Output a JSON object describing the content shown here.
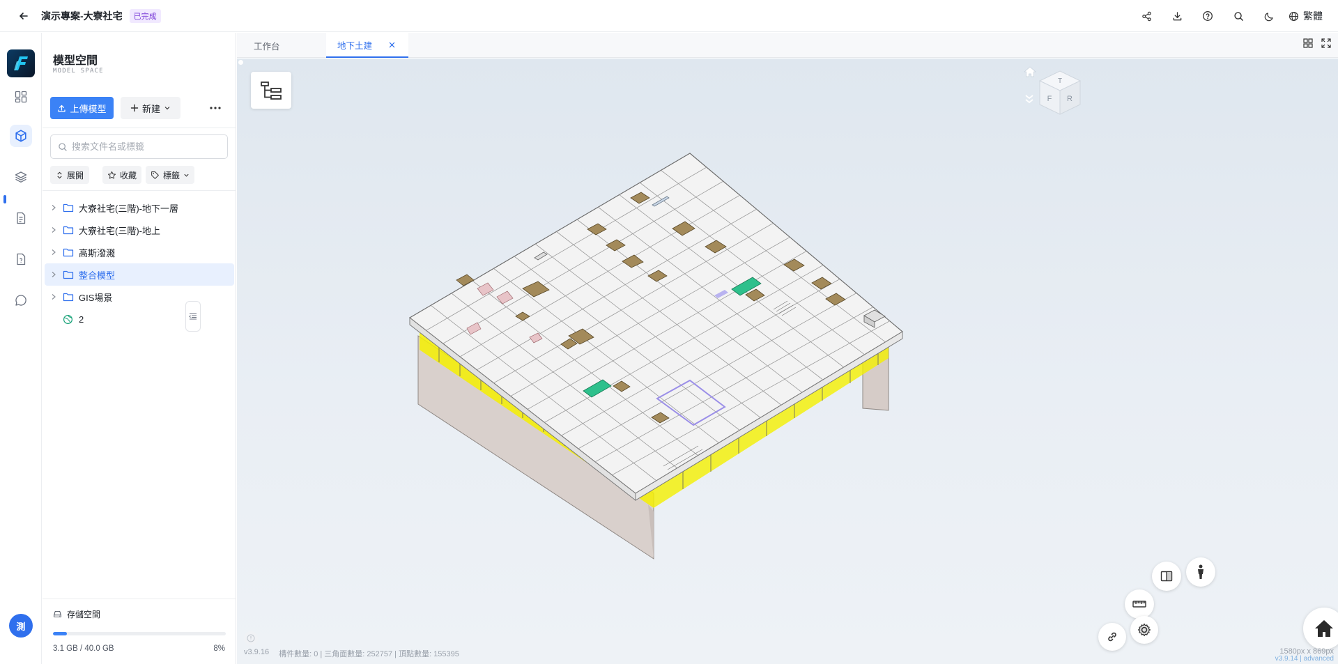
{
  "header": {
    "project_title": "演示專案-大寮社宅",
    "status_badge": "已完成",
    "language": "繁體"
  },
  "panel": {
    "title": "模型空間",
    "subtitle": "MODEL SPACE",
    "upload_label": "上傳模型",
    "new_label": "新建",
    "search_placeholder": "搜索文件名或標籤",
    "filters": {
      "expand": "展開",
      "favorite": "收藏",
      "tags": "標籤"
    },
    "tree": [
      {
        "label": "大寮社宅(三階)-地下一層",
        "type": "folder"
      },
      {
        "label": "大寮社宅(三階)-地上",
        "type": "folder"
      },
      {
        "label": "高斯潑濺",
        "type": "folder"
      },
      {
        "label": "整合模型",
        "type": "folder"
      },
      {
        "label": "GIS場景",
        "type": "folder"
      },
      {
        "label": "2",
        "type": "globe"
      }
    ],
    "storage": {
      "label": "存儲空間",
      "used": "3.1 GB / 40.0 GB",
      "percent": "8%",
      "fraction": 0.08
    }
  },
  "user": {
    "avatar_initial": "測"
  },
  "tabs": [
    {
      "label": "工作台"
    },
    {
      "label": "地下土建"
    }
  ],
  "viewer": {
    "version": "v3.9.16",
    "stats": "構件數量: 0 | 三角面數量: 252757 | 頂點數量: 155395",
    "dims": "1580px x 869px",
    "dims_version": "v3.9.14 | advanced",
    "viewcube_faces": {
      "top": "T",
      "front": "F",
      "right": "R"
    }
  },
  "colors": {
    "accent": "#2f6fed",
    "primary_button": "#3b82f6",
    "badge": "#7b3fd8",
    "viewport_bg": "#e3e9f0"
  }
}
